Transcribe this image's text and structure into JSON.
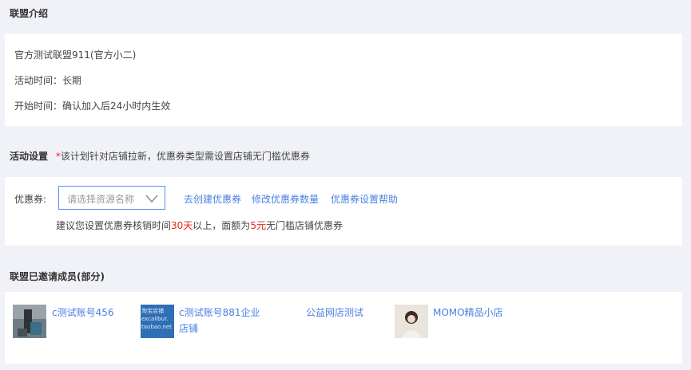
{
  "intro": {
    "title": "联盟介绍",
    "name": "官方测试联盟911(官方小二)",
    "time_label": "活动时间：",
    "time_value": "长期",
    "start_label": "开始时间：",
    "start_value": "确认加入后24小时内生效"
  },
  "settings": {
    "title": "活动设置",
    "note_star": "*",
    "note": "该计划针对店铺拉新，优惠券类型需设置店铺无门槛优惠券",
    "coupon_label": "优惠券:",
    "select_placeholder": "请选择资源名称",
    "links": [
      "去创建优惠券",
      "修改优惠券数量",
      "优惠券设置帮助"
    ],
    "hint_prefix": "建议您设置优惠券核销时间",
    "hint_days": "30天",
    "hint_mid": "以上，面额为",
    "hint_amount": "5元",
    "hint_suffix": "无门槛店铺优惠券"
  },
  "members": {
    "title": "联盟已邀请成员(部分)",
    "items": [
      {
        "name": "c测试账号456"
      },
      {
        "name_line1": "c测试账号881企业",
        "name_line2": "店铺",
        "thumb_text": [
          "淘宝店铺",
          "excalibur.",
          "taobao.net"
        ]
      },
      {
        "name": "公益网店测试"
      },
      {
        "name": "MOMO精品小店"
      }
    ]
  },
  "colors": {
    "link": "#4a7fe0",
    "accent_red": "#e8251b",
    "background": "#f0f2f7"
  }
}
